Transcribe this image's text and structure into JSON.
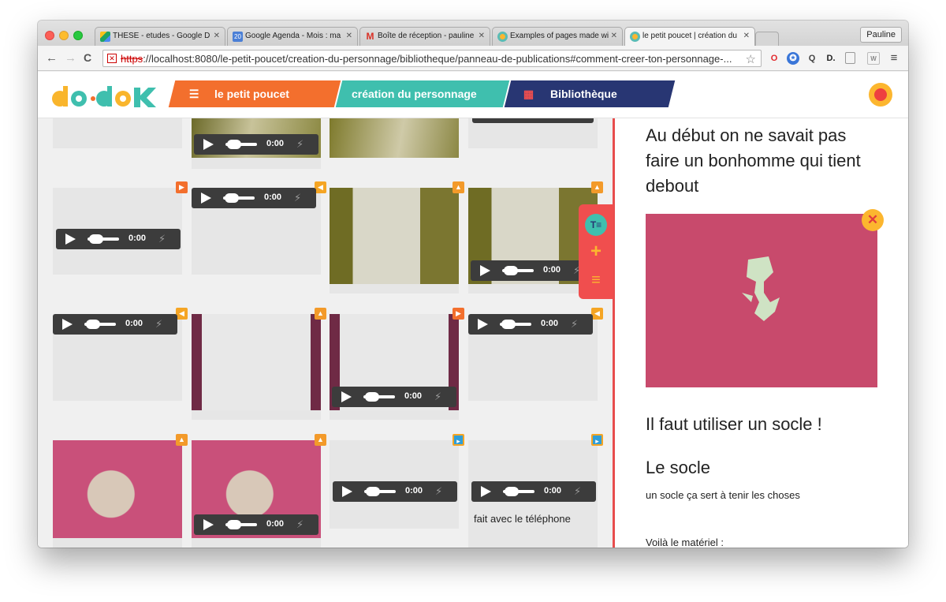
{
  "browser": {
    "tabs": [
      {
        "label": "THESE - etudes - Google D",
        "icon": "google-drive-icon",
        "color": "#3b7ddd"
      },
      {
        "label": "Google Agenda - Mois : ma",
        "icon": "google-calendar-icon",
        "color": "#4a7fd6",
        "favtext": "20"
      },
      {
        "label": "Boîte de réception - pauline",
        "icon": "gmail-icon",
        "color": "#d93025",
        "favtext": "M"
      },
      {
        "label": "Examples of pages made wi",
        "icon": "dodoc-icon",
        "color": "#5bbcb4"
      },
      {
        "label": "le petit poucet | création du",
        "icon": "dodoc-icon",
        "color": "#5bbcb4"
      }
    ],
    "profile": "Pauline",
    "url_scheme": "https",
    "url_rest": "://localhost:8080/le-petit-poucet/creation-du-personnage/bibliotheque/panneau-de-publications#comment-creer-ton-personnage-...",
    "nav": {
      "back": "←",
      "forward": "→",
      "reload": "C"
    }
  },
  "app": {
    "logo": "do•doc",
    "breadcrumbs": [
      {
        "label": "le petit poucet",
        "icon": "menu-icon",
        "color": "#f36f2d"
      },
      {
        "label": "création du personnage",
        "color": "#3fbfae"
      },
      {
        "label": "Bibliothèque",
        "icon": "grid-icon",
        "color": "#283673"
      }
    ],
    "colors": {
      "orange": "#f36f2d",
      "teal": "#3fbfae",
      "navy": "#283673",
      "red": "#f04e4e",
      "yellow": "#fcb62f"
    }
  },
  "media": {
    "time_label": "0:00",
    "caption_phone": "fait avec le téléphone"
  },
  "publication": {
    "title": "Au début on ne savait pas faire un bonhomme qui tient debout",
    "heading2": "Il faut utiliser un socle !",
    "heading3": "Le socle",
    "text1": "un socle ça sert à tenir les choses",
    "text2": "Voilà le matériel :"
  },
  "tools": {
    "text_tool": "T≡",
    "add_tool": "+",
    "more_tool": "≡"
  }
}
